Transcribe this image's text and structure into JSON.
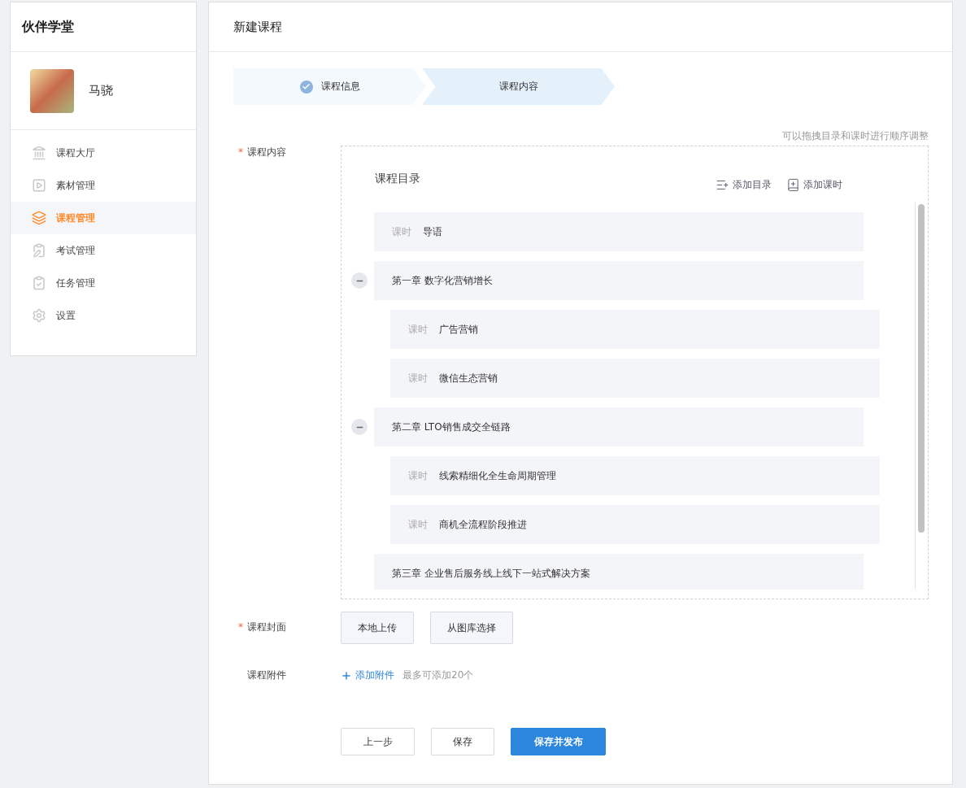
{
  "sidebar": {
    "brand": "伙伴学堂",
    "user": {
      "name": "马骁"
    },
    "items": [
      {
        "label": "课程大厅",
        "selected": false
      },
      {
        "label": "素材管理",
        "selected": false
      },
      {
        "label": "课程管理",
        "selected": true
      },
      {
        "label": "考试管理",
        "selected": false
      },
      {
        "label": "任务管理",
        "selected": false
      },
      {
        "label": "设置",
        "selected": false
      }
    ]
  },
  "page": {
    "title": "新建课程"
  },
  "steps": [
    {
      "label": "课程信息",
      "done": true
    },
    {
      "label": "课程内容",
      "done": false
    }
  ],
  "form": {
    "content": {
      "label": "课程内容",
      "required_mark": "*",
      "hint": "可以拖拽目录和课时进行顺序调整",
      "catalog_title": "课程目录",
      "actions": [
        "添加目录",
        "添加课时"
      ],
      "tree": [
        {
          "kind": "lesson",
          "tag": "课时",
          "title": "导语"
        },
        {
          "kind": "chapter",
          "title": "第一章 数字化营销增长",
          "expanded": true,
          "children": [
            {
              "kind": "lesson",
              "tag": "课时",
              "title": "广告营销"
            },
            {
              "kind": "lesson",
              "tag": "课时",
              "title": "微信生态营销"
            }
          ]
        },
        {
          "kind": "chapter",
          "title": "第二章 LTO销售成交全链路",
          "expanded": true,
          "children": [
            {
              "kind": "lesson",
              "tag": "课时",
              "title": "线索精细化全生命周期管理"
            },
            {
              "kind": "lesson",
              "tag": "课时",
              "title": "商机全流程阶段推进"
            }
          ]
        },
        {
          "kind": "chapter",
          "title": "第三章 企业售后服务线上线下一站式解决方案"
        }
      ]
    },
    "cover": {
      "label": "课程封面",
      "required_mark": "*",
      "buttons": [
        "本地上传",
        "从图库选择"
      ]
    },
    "attachment": {
      "label": "课程附件",
      "add": "添加附件",
      "note": "最多可添加20个"
    }
  },
  "footer": [
    {
      "label": "上一步",
      "primary": false
    },
    {
      "label": "保存",
      "primary": false
    },
    {
      "label": "保存并发布",
      "primary": true
    }
  ]
}
